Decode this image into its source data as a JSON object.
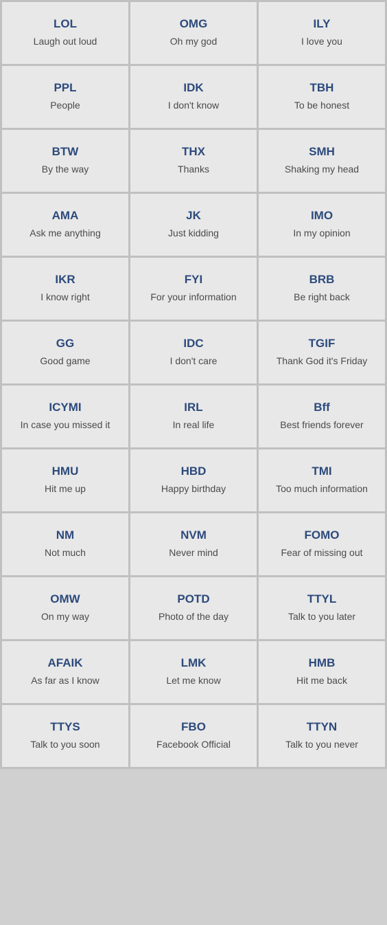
{
  "items": [
    {
      "abbr": "LOL",
      "meaning": "Laugh out loud"
    },
    {
      "abbr": "OMG",
      "meaning": "Oh my god"
    },
    {
      "abbr": "ILY",
      "meaning": "I love you"
    },
    {
      "abbr": "PPL",
      "meaning": "People"
    },
    {
      "abbr": "IDK",
      "meaning": "I don't know"
    },
    {
      "abbr": "TBH",
      "meaning": "To be honest"
    },
    {
      "abbr": "BTW",
      "meaning": "By the way"
    },
    {
      "abbr": "THX",
      "meaning": "Thanks"
    },
    {
      "abbr": "SMH",
      "meaning": "Shaking my head"
    },
    {
      "abbr": "AMA",
      "meaning": "Ask me anything"
    },
    {
      "abbr": "JK",
      "meaning": "Just kidding"
    },
    {
      "abbr": "IMO",
      "meaning": "In my opinion"
    },
    {
      "abbr": "IKR",
      "meaning": "I know right"
    },
    {
      "abbr": "FYI",
      "meaning": "For your information"
    },
    {
      "abbr": "BRB",
      "meaning": "Be right back"
    },
    {
      "abbr": "GG",
      "meaning": "Good game"
    },
    {
      "abbr": "IDC",
      "meaning": "I don't care"
    },
    {
      "abbr": "TGIF",
      "meaning": "Thank God it's Friday"
    },
    {
      "abbr": "ICYMI",
      "meaning": "In case you missed it"
    },
    {
      "abbr": "IRL",
      "meaning": "In real life"
    },
    {
      "abbr": "Bff",
      "meaning": "Best friends forever"
    },
    {
      "abbr": "HMU",
      "meaning": "Hit me up"
    },
    {
      "abbr": "HBD",
      "meaning": "Happy birthday"
    },
    {
      "abbr": "TMI",
      "meaning": "Too much information"
    },
    {
      "abbr": "NM",
      "meaning": "Not much"
    },
    {
      "abbr": "NVM",
      "meaning": "Never mind"
    },
    {
      "abbr": "FOMO",
      "meaning": "Fear of missing out"
    },
    {
      "abbr": "OMW",
      "meaning": "On my way"
    },
    {
      "abbr": "POTD",
      "meaning": "Photo of the day"
    },
    {
      "abbr": "TTYL",
      "meaning": "Talk to you later"
    },
    {
      "abbr": "AFAIK",
      "meaning": "As far as I know"
    },
    {
      "abbr": "LMK",
      "meaning": "Let me know"
    },
    {
      "abbr": "HMB",
      "meaning": "Hit me back"
    },
    {
      "abbr": "TTYS",
      "meaning": "Talk to you soon"
    },
    {
      "abbr": "FBO",
      "meaning": "Facebook Official"
    },
    {
      "abbr": "TTYN",
      "meaning": "Talk to you never"
    }
  ]
}
